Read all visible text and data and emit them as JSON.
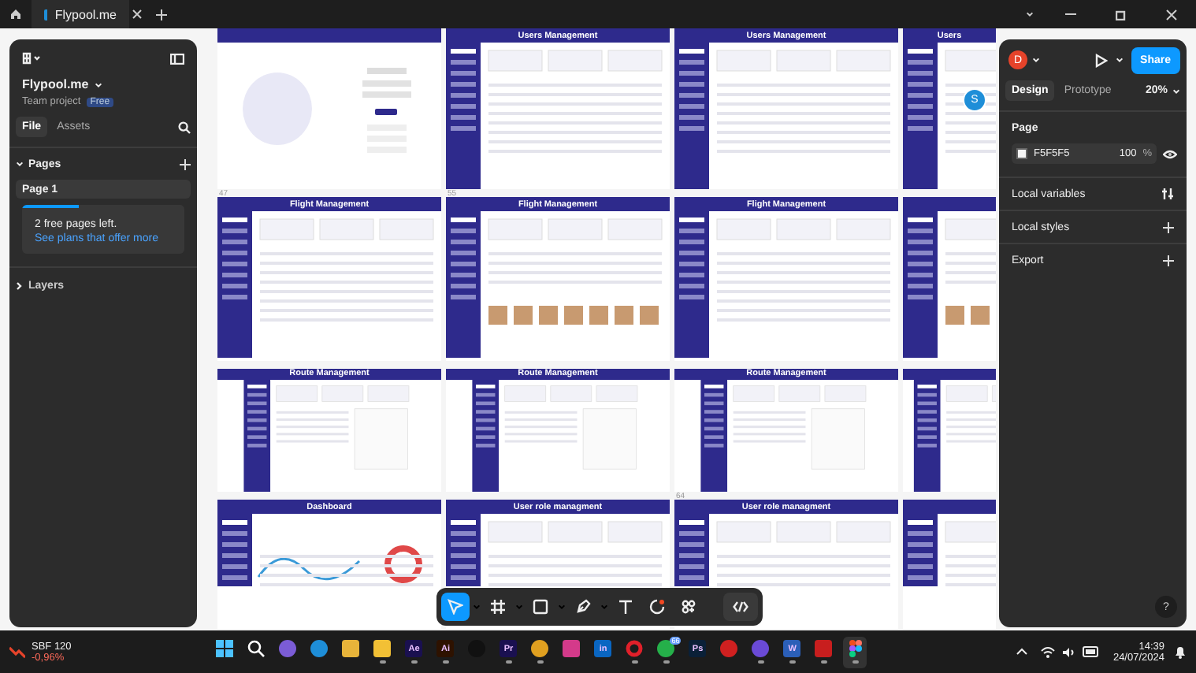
{
  "browser": {
    "tabs": [
      {
        "label": "Flypool.me",
        "selected": true
      }
    ]
  },
  "left_panel": {
    "project": "Flypool.me",
    "team": "Team project",
    "plan_badge": "Free",
    "tabs": [
      {
        "label": "File",
        "selected": true
      },
      {
        "label": "Assets",
        "selected": false
      }
    ],
    "pages_title": "Pages",
    "pages": [
      {
        "label": "Page 1",
        "selected": true
      }
    ],
    "upsell": {
      "level": 0.35,
      "text": "2 free pages left.",
      "link": "See plans that offer more"
    },
    "layers_title": "Layers"
  },
  "right_panel": {
    "avatar": "D",
    "share": "Share",
    "tabs": [
      {
        "label": "Design",
        "selected": true
      },
      {
        "label": "Prototype",
        "selected": false
      }
    ],
    "zoom": "20%",
    "page_title": "Page",
    "fill_hex": "F5F5F5",
    "opacity": "100",
    "percent": "%",
    "sections": [
      {
        "label": "Local variables",
        "kind": "variables"
      },
      {
        "label": "Local styles",
        "kind": "add"
      },
      {
        "label": "Export",
        "kind": "add"
      }
    ],
    "help": "?"
  },
  "canvas": {
    "collaborator": "S",
    "frames": [
      {
        "kind": "login",
        "label": "47"
      },
      {
        "kind": "table",
        "title": "Users Management",
        "label": "55"
      },
      {
        "kind": "table",
        "title": "Users Management"
      },
      {
        "kind": "table",
        "title": "Users"
      },
      {
        "kind": "table",
        "title": "Flight Management"
      },
      {
        "kind": "photos",
        "title": "Flight Management"
      },
      {
        "kind": "table",
        "title": "Flight Management"
      },
      {
        "kind": "photos"
      },
      {
        "kind": "form",
        "title": "Route Management"
      },
      {
        "kind": "form",
        "title": "Route Management"
      },
      {
        "kind": "form",
        "title": "Route Management",
        "label": "64"
      },
      {
        "kind": "form"
      },
      {
        "kind": "chart",
        "title": "Dashboard"
      },
      {
        "kind": "roles",
        "title": "User role managment"
      },
      {
        "kind": "roles",
        "title": "User role managment"
      },
      {
        "kind": "roles"
      }
    ]
  },
  "toolbar": {
    "tools": [
      {
        "kind": "move",
        "selected": true,
        "menu": true
      },
      {
        "kind": "frame",
        "selected": false,
        "menu": true
      },
      {
        "kind": "rect",
        "selected": false,
        "menu": true
      },
      {
        "kind": "pen",
        "selected": false,
        "menu": true
      },
      {
        "kind": "text",
        "selected": false,
        "menu": false
      },
      {
        "kind": "comment",
        "selected": false,
        "menu": false
      },
      {
        "kind": "actions",
        "selected": false,
        "menu": false
      }
    ]
  },
  "taskbar": {
    "ticker": {
      "name": "SBF 120",
      "change": "-0,96%"
    },
    "apps": [
      {
        "kind": "start",
        "running": false
      },
      {
        "kind": "search",
        "running": false
      },
      {
        "kind": "circle",
        "color": "#7b5cd6",
        "running": false
      },
      {
        "kind": "circle",
        "color": "#1e8ed8",
        "running": false
      },
      {
        "kind": "square",
        "color": "#e8b43a",
        "running": false
      },
      {
        "kind": "square",
        "color": "#f2c035",
        "running": true
      },
      {
        "kind": "letters",
        "label": "Ae",
        "color": "#1a1050",
        "running": true
      },
      {
        "kind": "letters",
        "label": "Ai",
        "color": "#2e1200",
        "running": true
      },
      {
        "kind": "circle",
        "color": "#111111",
        "running": false
      },
      {
        "kind": "letters",
        "label": "Pr",
        "color": "#1a1050",
        "running": true
      },
      {
        "kind": "circle",
        "color": "#e0a020",
        "running": true
      },
      {
        "kind": "square",
        "color": "#d43a8a",
        "running": false
      },
      {
        "kind": "letters",
        "label": "in",
        "color": "#0a66c2",
        "running": false
      },
      {
        "kind": "ring",
        "color": "#e0202a",
        "running": true
      },
      {
        "kind": "circle",
        "color": "#25b04a",
        "badge": "66",
        "running": true
      },
      {
        "kind": "letters",
        "label": "Ps",
        "color": "#0a2038",
        "running": false
      },
      {
        "kind": "circle",
        "color": "#d02020",
        "running": false
      },
      {
        "kind": "circle",
        "color": "#6a4ad6",
        "running": true
      },
      {
        "kind": "letters",
        "label": "W",
        "color": "#2b5fb8",
        "running": true
      },
      {
        "kind": "square",
        "color": "#c81e1e",
        "running": true
      },
      {
        "kind": "figma",
        "running": true,
        "selected": true
      }
    ],
    "time": "14:39",
    "date": "24/07/2024"
  }
}
